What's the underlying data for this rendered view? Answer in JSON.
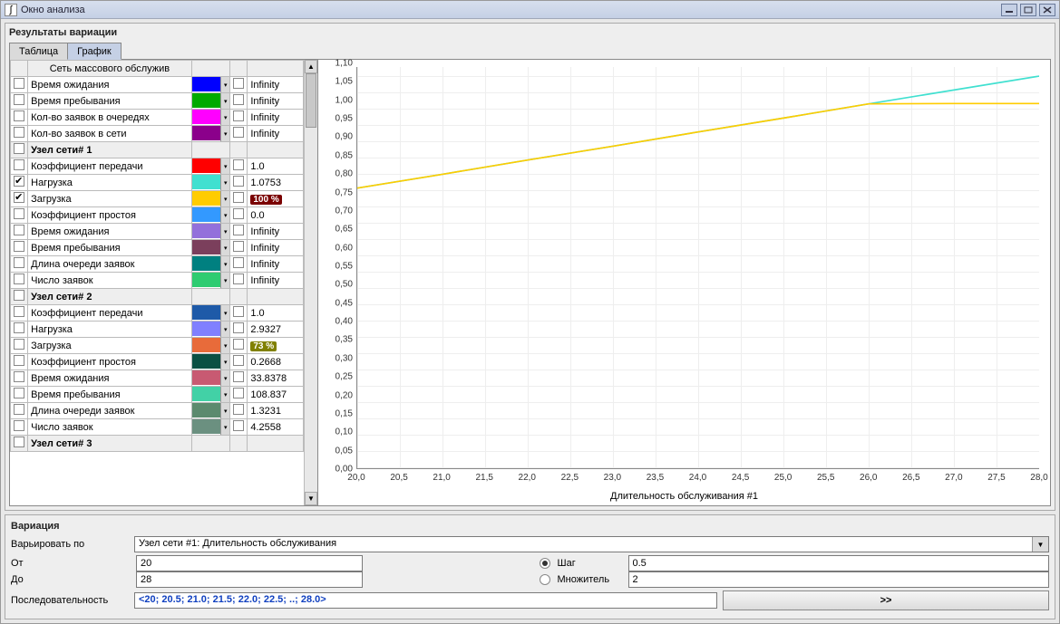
{
  "window": {
    "title": "Окно анализа"
  },
  "results": {
    "title": "Результаты вариации",
    "tabs": [
      {
        "label": "Таблица",
        "active": false
      },
      {
        "label": "График",
        "active": true
      }
    ]
  },
  "table": {
    "header": "Сеть массового обслужив",
    "sections": [
      {
        "title": "Сеть массового обслужив",
        "rows": [
          {
            "name": "Время ожидания",
            "color": "#0000ff",
            "checked": false,
            "chk2": false,
            "val": "Infinity"
          },
          {
            "name": "Время пребывания",
            "color": "#00aa00",
            "checked": false,
            "chk2": false,
            "val": "Infinity"
          },
          {
            "name": "Кол-во заявок в очередях",
            "color": "#ff00ff",
            "checked": false,
            "chk2": false,
            "val": "Infinity"
          },
          {
            "name": "Кол-во заявок в сети",
            "color": "#8b008b",
            "checked": false,
            "chk2": false,
            "val": "Infinity"
          }
        ]
      },
      {
        "title": "Узел сети# 1",
        "rows": [
          {
            "name": "Коэффициент передачи",
            "color": "#ff0000",
            "checked": false,
            "chk2": false,
            "val": "1.0"
          },
          {
            "name": "Нагрузка",
            "color": "#40e0d0",
            "checked": true,
            "chk2": false,
            "val": "1.0753"
          },
          {
            "name": "Загрузка",
            "color": "#ffcc00",
            "checked": true,
            "chk2": false,
            "val": "100 %",
            "badge": "red"
          },
          {
            "name": "Коэффициент простоя",
            "color": "#3399ff",
            "checked": false,
            "chk2": false,
            "val": "0.0"
          },
          {
            "name": "Время ожидания",
            "color": "#9370db",
            "checked": false,
            "chk2": false,
            "val": "Infinity"
          },
          {
            "name": "Время пребывания",
            "color": "#7b3f5c",
            "checked": false,
            "chk2": false,
            "val": "Infinity"
          },
          {
            "name": "Длина очереди заявок",
            "color": "#008080",
            "checked": false,
            "chk2": false,
            "val": "Infinity"
          },
          {
            "name": "Число заявок",
            "color": "#2ecc71",
            "checked": false,
            "chk2": false,
            "val": "Infinity"
          }
        ]
      },
      {
        "title": "Узел сети# 2",
        "rows": [
          {
            "name": "Коэффициент передачи",
            "color": "#1e5aa8",
            "checked": false,
            "chk2": false,
            "val": "1.0"
          },
          {
            "name": "Нагрузка",
            "color": "#8080ff",
            "checked": false,
            "chk2": false,
            "val": "2.9327"
          },
          {
            "name": "Загрузка",
            "color": "#e86b3a",
            "checked": false,
            "chk2": false,
            "val": "73 %",
            "badge": "olive"
          },
          {
            "name": "Коэффициент простоя",
            "color": "#0a5043",
            "checked": false,
            "chk2": false,
            "val": "0.2668"
          },
          {
            "name": "Время ожидания",
            "color": "#c85a72",
            "checked": false,
            "chk2": false,
            "val": "33.8378"
          },
          {
            "name": "Время пребывания",
            "color": "#42d1a6",
            "checked": false,
            "chk2": false,
            "val": "108.837"
          },
          {
            "name": "Длина очереди заявок",
            "color": "#5c8a6e",
            "checked": false,
            "chk2": false,
            "val": "1.3231"
          },
          {
            "name": "Число заявок",
            "color": "#6b9080",
            "checked": false,
            "chk2": false,
            "val": "4.2558"
          }
        ]
      },
      {
        "title": "Узел сети# 3",
        "rows": []
      }
    ]
  },
  "chart_data": {
    "type": "line",
    "xlabel": "Длительность обслуживания #1",
    "ylabel": "",
    "xlim": [
      20,
      28
    ],
    "ylim": [
      0,
      1.1
    ],
    "xticks": [
      20.0,
      20.5,
      21.0,
      21.5,
      22.0,
      22.5,
      23.0,
      23.5,
      24.0,
      24.5,
      25.0,
      25.5,
      26.0,
      26.5,
      27.0,
      27.5,
      28.0
    ],
    "yticks": [
      0.0,
      0.05,
      0.1,
      0.15,
      0.2,
      0.25,
      0.3,
      0.35,
      0.4,
      0.45,
      0.5,
      0.55,
      0.6,
      0.65,
      0.7,
      0.75,
      0.8,
      0.85,
      0.9,
      0.95,
      1.0,
      1.05,
      1.1
    ],
    "series": [
      {
        "name": "Нагрузка (Узел сети #1)",
        "color": "#40e0d0",
        "x": [
          20,
          21,
          22,
          23,
          24,
          25,
          26,
          27,
          28
        ],
        "y": [
          0.768,
          0.806,
          0.845,
          0.883,
          0.922,
          0.96,
          0.999,
          1.037,
          1.075
        ]
      },
      {
        "name": "Загрузка (Узел сети #1)",
        "color": "#ffcc00",
        "x": [
          20,
          21,
          22,
          23,
          24,
          25,
          26,
          27,
          28
        ],
        "y": [
          0.768,
          0.806,
          0.845,
          0.883,
          0.922,
          0.96,
          0.999,
          1.0,
          1.0
        ]
      }
    ]
  },
  "variation": {
    "title": "Вариация",
    "vary_label": "Варьировать по",
    "vary_value": "Узел сети #1: Длительность обслуживания",
    "from_label": "От",
    "from_value": "20",
    "to_label": "До",
    "to_value": "28",
    "step_label": "Шаг",
    "step_value": "0.5",
    "step_selected": true,
    "mult_label": "Множитель",
    "mult_value": "2",
    "mult_selected": false,
    "seq_label": "Последовательность",
    "seq_value": "<20; 20.5; 21.0; 21.5; 22.0; 22.5; ..; 28.0>",
    "run_label": ">>"
  }
}
